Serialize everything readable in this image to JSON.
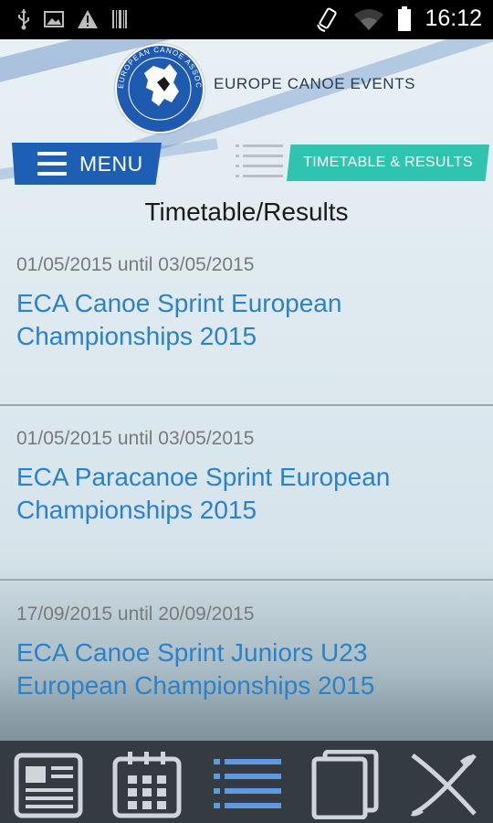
{
  "status_bar": {
    "time": "16:12",
    "icons": [
      "usb-icon",
      "image-icon",
      "warning-icon",
      "barcode-icon",
      "rotate-icon",
      "wifi-icon",
      "battery-icon"
    ]
  },
  "header": {
    "logo_ring_text": "EUROPEAN CANOE ASSOCIATION",
    "brand_title": "EUROPE CANOE EVENTS",
    "menu_label": "MENU",
    "timetable_label": "TIMETABLE & RESULTS"
  },
  "page_title": "Timetable/Results",
  "events": [
    {
      "dates": "01/05/2015 until 03/05/2015",
      "name": "ECA Canoe Sprint European Championships 2015"
    },
    {
      "dates": "01/05/2015 until 03/05/2015",
      "name": "ECA Paracanoe Sprint European Championships 2015"
    },
    {
      "dates": "17/09/2015 until 20/09/2015",
      "name": "ECA Canoe Sprint Juniors U23 European Championships 2015"
    }
  ],
  "bottom_nav": {
    "items": [
      {
        "icon": "newspaper-icon"
      },
      {
        "icon": "calendar-icon"
      },
      {
        "icon": "list-icon",
        "active": true
      },
      {
        "icon": "documents-icon"
      },
      {
        "icon": "kayak-paddle-icon"
      }
    ]
  },
  "colors": {
    "brand_blue": "#1d5fb4",
    "teal": "#2ec4b0",
    "link_blue": "#2a82c9",
    "date_gray": "#7a7a7a",
    "nav_bg": "#343b41"
  }
}
